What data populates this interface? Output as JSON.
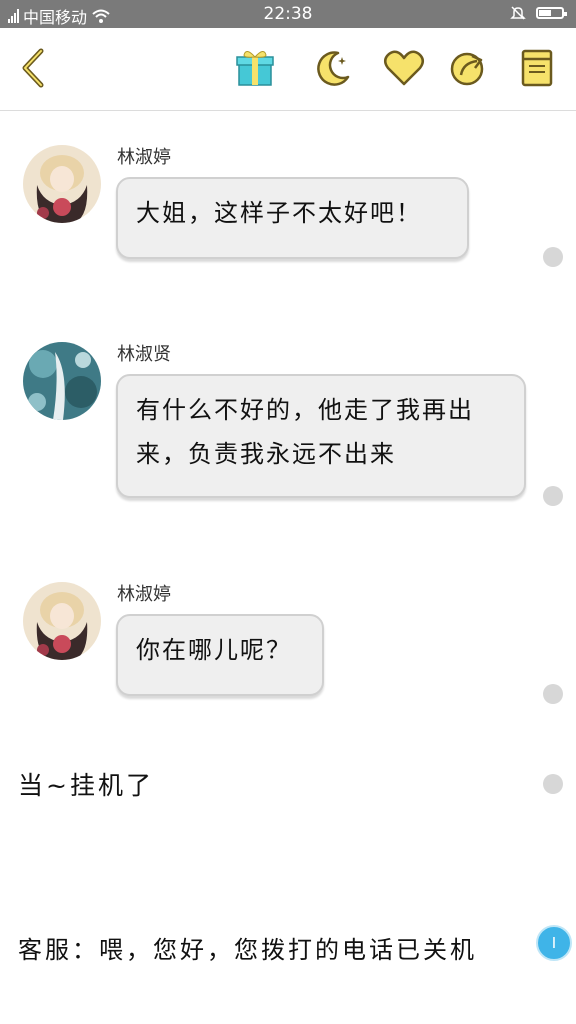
{
  "status_bar": {
    "carrier": "中国移动",
    "time": "22:38",
    "battery_level": 0.55
  },
  "toolbar": {
    "icons": [
      "back-chevron-icon",
      "gift-icon",
      "moon-icon",
      "heart-icon",
      "share-icon",
      "notebook-icon"
    ],
    "accent_color": "#f6e26b",
    "outline_color": "#6b5a1e"
  },
  "messages": [
    {
      "sender": "林淑婷",
      "text": "大姐，这样子不太好吧！"
    },
    {
      "sender": "林淑贤",
      "text": "有什么不好的，他走了我再出来，负责我永远不出来"
    },
    {
      "sender": "林淑婷",
      "text": "你在哪儿呢？"
    }
  ],
  "narration": [
    "当~挂机了",
    "客服：喂，您好，您拨打的电话已关机"
  ],
  "bottom_dot_label": "I"
}
